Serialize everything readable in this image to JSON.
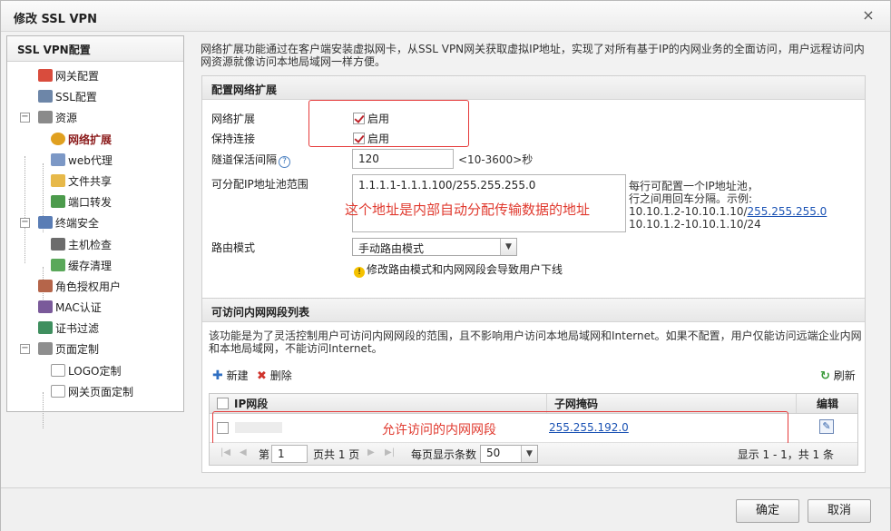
{
  "window": {
    "title": "修改 SSL VPN",
    "close": "×"
  },
  "sidebar": {
    "header": "SSL VPN配置",
    "items": [
      {
        "label": "网关配置",
        "icon": "gateway-icon"
      },
      {
        "label": "SSL配置",
        "icon": "ssl-icon"
      },
      {
        "label": "资源",
        "icon": "resource-icon",
        "toggle": "−"
      },
      {
        "label": "网络扩展",
        "icon": "network-extension-icon"
      },
      {
        "label": "web代理",
        "icon": "web-proxy-icon"
      },
      {
        "label": "文件共享",
        "icon": "folder-icon"
      },
      {
        "label": "端口转发",
        "icon": "port-forward-icon"
      },
      {
        "label": "终端安全",
        "icon": "terminal-security-icon",
        "toggle": "−"
      },
      {
        "label": "主机检查",
        "icon": "host-check-icon"
      },
      {
        "label": "缓存清理",
        "icon": "cache-clean-icon"
      },
      {
        "label": "角色授权用户",
        "icon": "role-user-icon"
      },
      {
        "label": "MAC认证",
        "icon": "mac-auth-icon"
      },
      {
        "label": "证书过滤",
        "icon": "cert-filter-icon"
      },
      {
        "label": "页面定制",
        "icon": "page-custom-icon",
        "toggle": "−"
      },
      {
        "label": "LOGO定制",
        "icon": "logo-custom-icon"
      },
      {
        "label": "网关页面定制",
        "icon": "gateway-page-icon"
      }
    ]
  },
  "main": {
    "intro": "网络扩展功能通过在客户端安装虚拟网卡，从SSL VPN网关获取虚拟IP地址，实现了对所有基于IP的内网业务的全面访问，用户远程访问内网资源就像访问本地局域网一样方便。",
    "config": {
      "heading": "配置网络扩展",
      "network_extension_label": "网络扩展",
      "network_extension_value": "启用",
      "keepalive_label": "保持连接",
      "keepalive_value": "启用",
      "tunnel_interval_label": "隧道保活间隔",
      "tunnel_interval_value": "120",
      "tunnel_interval_hint": "<10-3600>秒",
      "pool_label": "可分配IP地址池范围",
      "pool_value": "1.1.1.1-1.1.1.100/255.255.255.0",
      "pool_annotation": "这个地址是内部自动分配传输数据的地址",
      "pool_hint_1": "每行可配置一个IP地址池，",
      "pool_hint_2": "行之间用回车分隔。示例:",
      "pool_hint_3a": "10.10.1.2-10.10.1.10/",
      "pool_hint_3b": "255.255.255.0",
      "pool_hint_4": "10.10.1.2-10.10.1.10/24",
      "route_label": "路由模式",
      "route_value": "手动路由模式",
      "route_warning": "修改路由模式和内网网段会导致用户下线"
    },
    "segments": {
      "heading": "可访问内网网段列表",
      "desc": "该功能是为了灵活控制用户可访问内网网段的范围，且不影响用户访问本地局域网和Internet。如果不配置，用户仅能访问远端企业内网和本地局域网，不能访问Internet。",
      "new_label": "新建",
      "delete_label": "删除",
      "refresh_label": "刷新",
      "col_ip": "IP网段",
      "col_mask": "子网掩码",
      "col_edit": "编辑",
      "rows": [
        {
          "ip": "",
          "mask": "255.255.192.0"
        }
      ],
      "row_annotation": "允许访问的内网网段",
      "pager": {
        "page_prefix": "第",
        "page_value": "1",
        "page_suffix": "页共 1 页",
        "per_page_label": "每页显示条数",
        "per_page_value": "50",
        "summary": "显示 1 - 1，共 1 条"
      }
    }
  },
  "footer": {
    "ok": "确定",
    "cancel": "取消"
  }
}
